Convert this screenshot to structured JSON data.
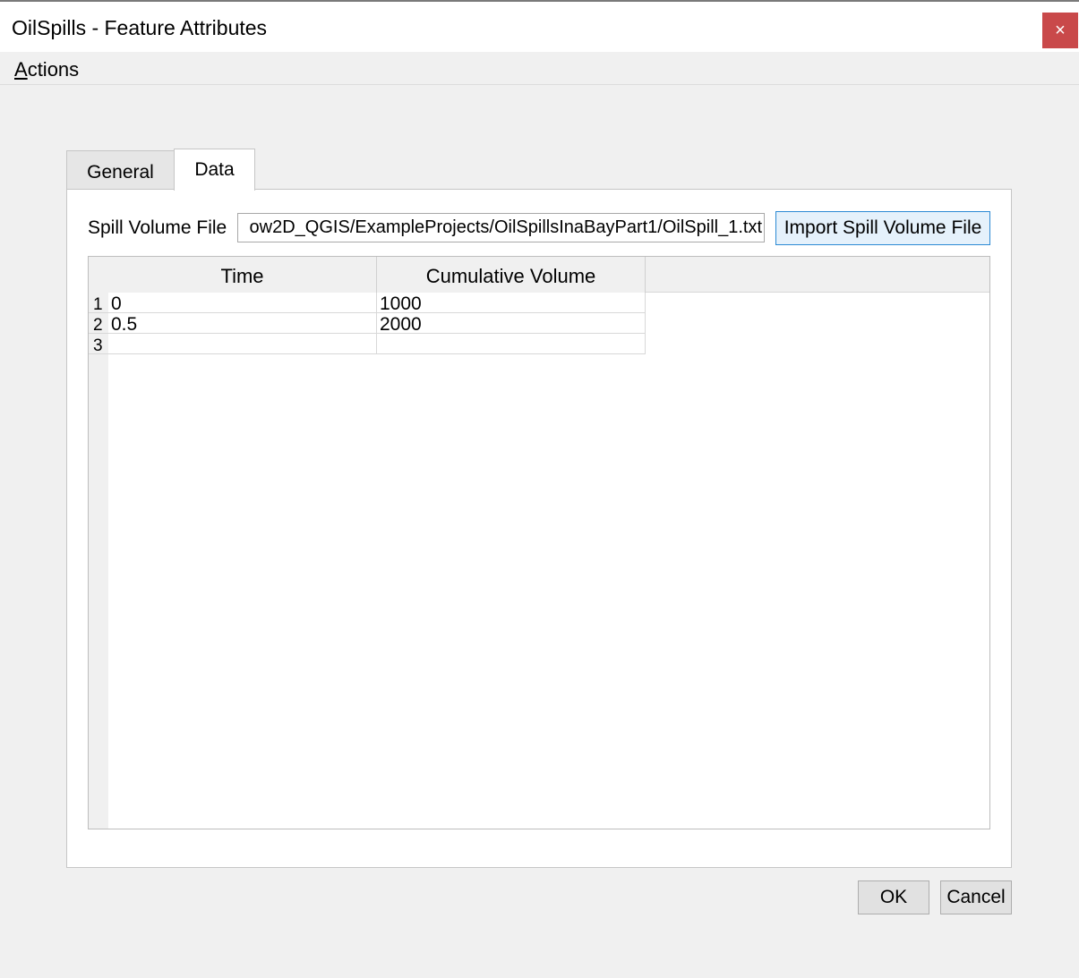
{
  "window": {
    "title": "OilSpills - Feature Attributes",
    "close_glyph": "×"
  },
  "menu": {
    "actions_mnemonic": "A",
    "actions_rest": "ctions"
  },
  "tabs": [
    {
      "label": "General",
      "selected": false
    },
    {
      "label": "Data",
      "selected": true
    }
  ],
  "data_tab": {
    "spill_volume_label": "Spill Volume File",
    "spill_volume_path": "ow2D_QGIS/ExampleProjects/OilSpillsInaBayPart1/OilSpill_1.txt",
    "import_button_label": "Import Spill Volume File"
  },
  "table": {
    "columns": [
      "Time",
      "Cumulative Volume"
    ],
    "rows": [
      {
        "num": "1",
        "time": "0",
        "volume": "1000"
      },
      {
        "num": "2",
        "time": "0.5",
        "volume": "2000"
      },
      {
        "num": "3",
        "time": "",
        "volume": ""
      }
    ]
  },
  "buttons": {
    "ok": "OK",
    "cancel": "Cancel"
  },
  "colors": {
    "close_button": "#c9494a",
    "import_button_border": "#2c8ad4",
    "import_button_bg": "#e5f1fb",
    "window_bg": "#f0f0f0"
  }
}
